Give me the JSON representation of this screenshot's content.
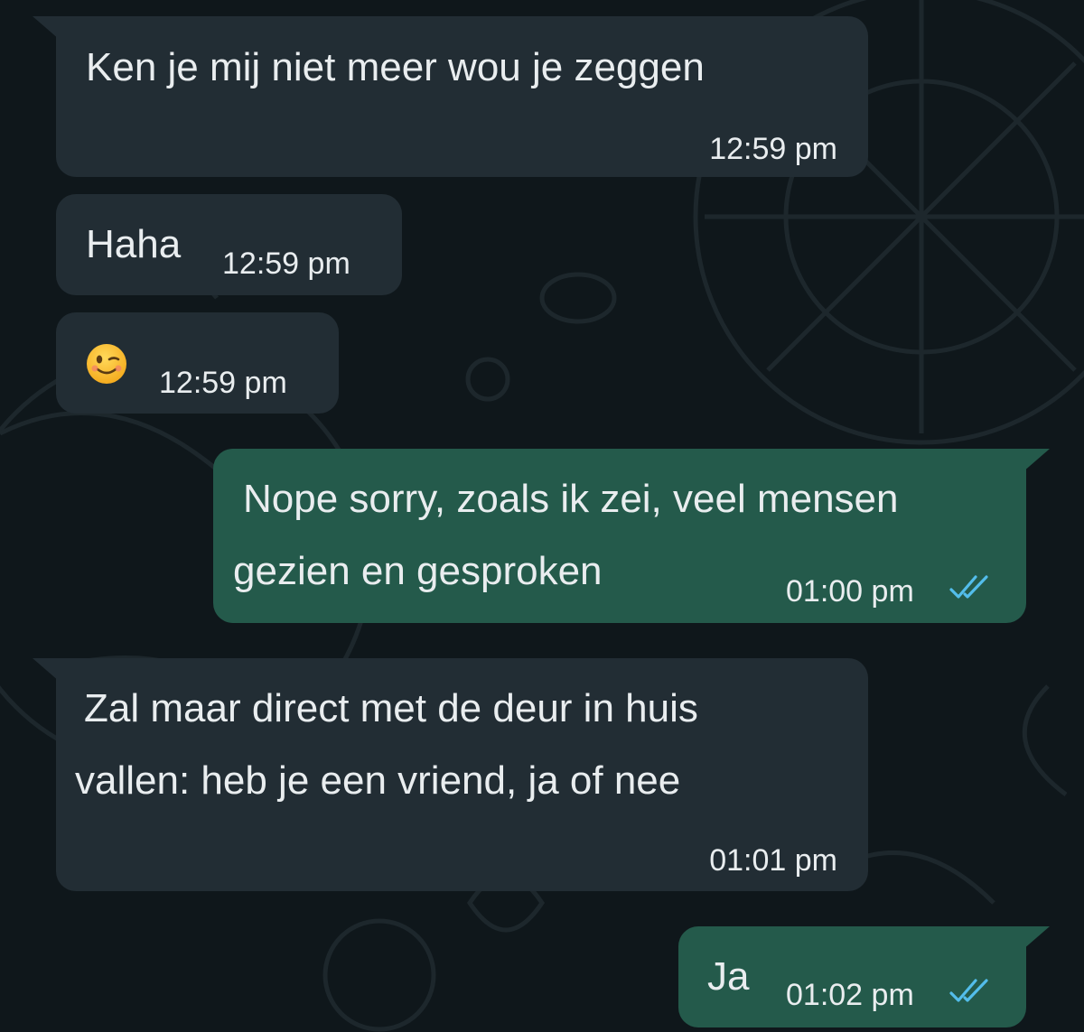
{
  "colors": {
    "background": "#0f171b",
    "incoming_bubble": "#222d34",
    "outgoing_bubble": "#245a4b",
    "text": "#e9edef",
    "read_ticks": "#53bdeb"
  },
  "messages": [
    {
      "direction": "incoming",
      "lines": [
        "Ken je mij niet meer wou je zeggen"
      ],
      "time": "12:59 pm"
    },
    {
      "direction": "incoming",
      "lines": [
        "Haha"
      ],
      "time": "12:59 pm"
    },
    {
      "direction": "incoming",
      "emoji": "winking-face",
      "time": "12:59 pm"
    },
    {
      "direction": "outgoing",
      "lines": [
        "Nope sorry, zoals ik zei, veel mensen",
        "gezien en gesproken"
      ],
      "time": "01:00 pm",
      "status_icon": "double-check-read"
    },
    {
      "direction": "incoming",
      "lines": [
        "Zal maar direct met de deur in huis",
        "vallen: heb je een vriend, ja of nee"
      ],
      "time": "01:01 pm"
    },
    {
      "direction": "outgoing",
      "lines": [
        "Ja"
      ],
      "time": "01:02 pm",
      "status_icon": "double-check-read"
    }
  ]
}
